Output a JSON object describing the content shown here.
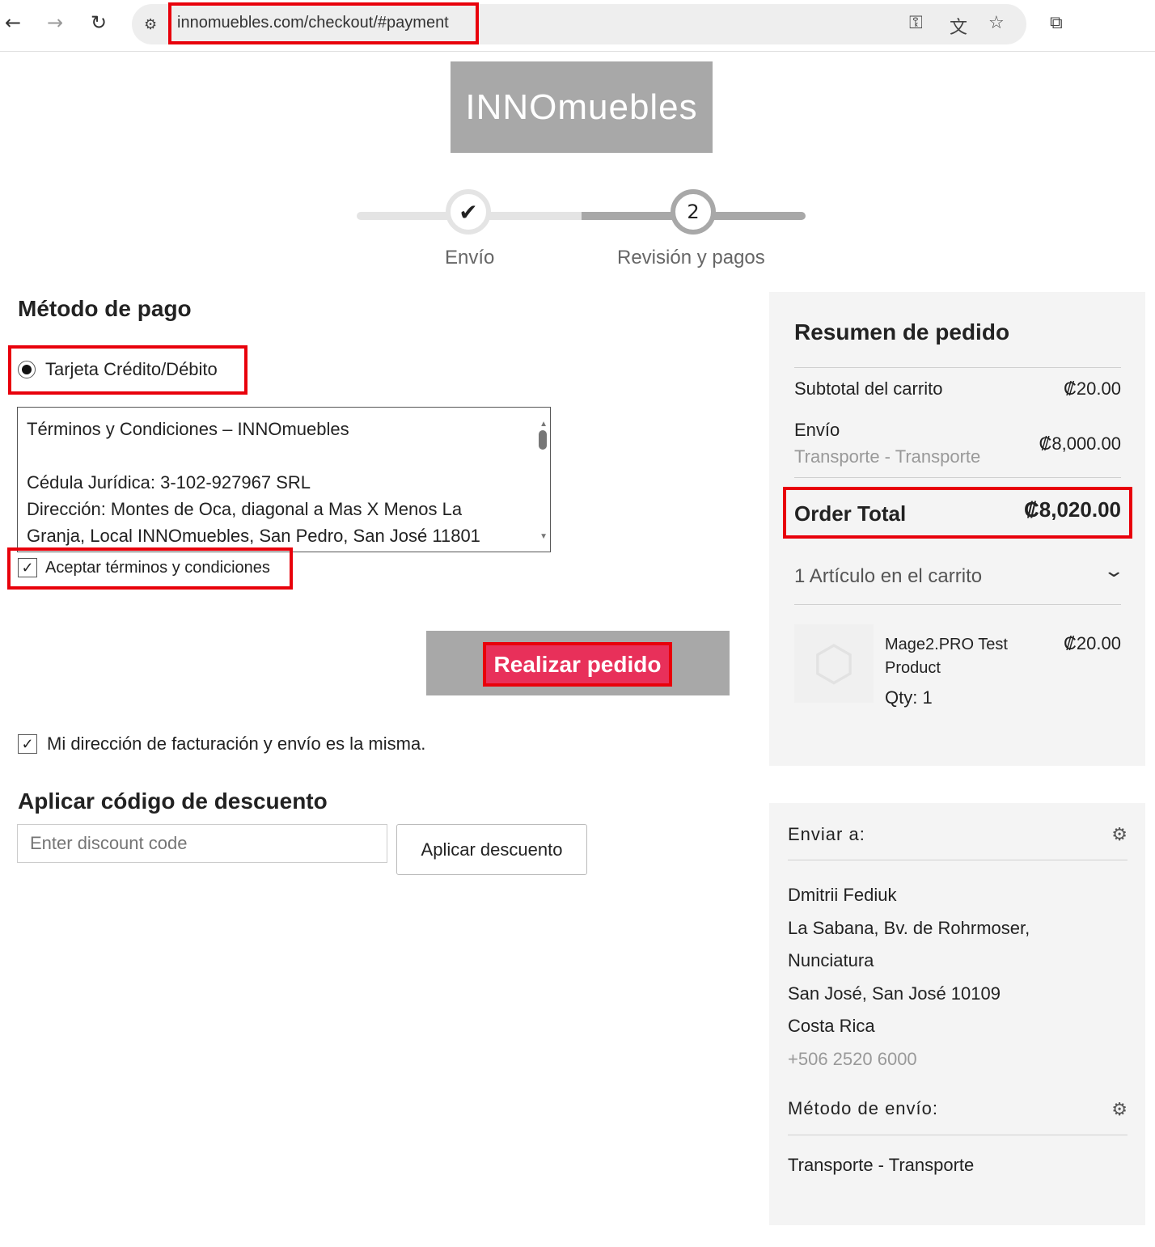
{
  "browser": {
    "url": "innomuebles.com/checkout/#payment",
    "icons": [
      "back-icon",
      "forward-icon",
      "reload-icon",
      "site-settings-icon",
      "password-key-icon",
      "translate-icon",
      "bookmark-star-icon",
      "extensions-icon"
    ]
  },
  "logo": {
    "text": "INNOmuebles"
  },
  "steps": [
    {
      "label": "Envío",
      "state": "complete"
    },
    {
      "label": "Revisión y pagos",
      "number": "2",
      "state": "active"
    }
  ],
  "payment": {
    "title": "Método de pago",
    "option": "Tarjeta Crédito/Débito",
    "selected": true,
    "terms": [
      "Términos y Condiciones – INNOmuebles",
      "",
      "Cédula Jurídica: 3-102-927967 SRL",
      "Dirección: Montes de Oca, diagonal a Mas X Menos La",
      "Granja, Local INNOmuebles, San Pedro, San José 11801"
    ],
    "accept_label": "Aceptar términos y condiciones",
    "accept_checked": true,
    "place_order": "Realizar pedido",
    "same_address_label": "Mi dirección de facturación y envío es la misma.",
    "same_address_checked": true
  },
  "discount": {
    "title": "Aplicar código de descuento",
    "placeholder": "Enter discount code",
    "button": "Aplicar descuento"
  },
  "summary": {
    "title": "Resumen de pedido",
    "subtotal_label": "Subtotal del carrito",
    "subtotal": "₡20.00",
    "shipping_label": "Envío",
    "shipping_method": "Transporte - Transporte",
    "shipping": "₡8,000.00",
    "total_label": "Order Total",
    "total": "₡8,020.00",
    "items_label": "1 Artículo en el carrito",
    "item": {
      "name": "Mage2.PRO Test Product",
      "price": "₡20.00",
      "qty": "Qty: 1"
    }
  },
  "ship_to": {
    "title": "Enviar a:",
    "lines": [
      "Dmitrii Fediuk",
      "La Sabana, Bv. de Rohrmoser,",
      "Nunciatura",
      "San José, San José 10109",
      "Costa Rica"
    ],
    "phone": "+506 2520 6000",
    "method_title": "Método de envío:",
    "method": "Transporte - Transporte"
  },
  "colors": {
    "highlight": "#e8000b",
    "button": "#e8305a",
    "panel": "#f4f4f4"
  }
}
